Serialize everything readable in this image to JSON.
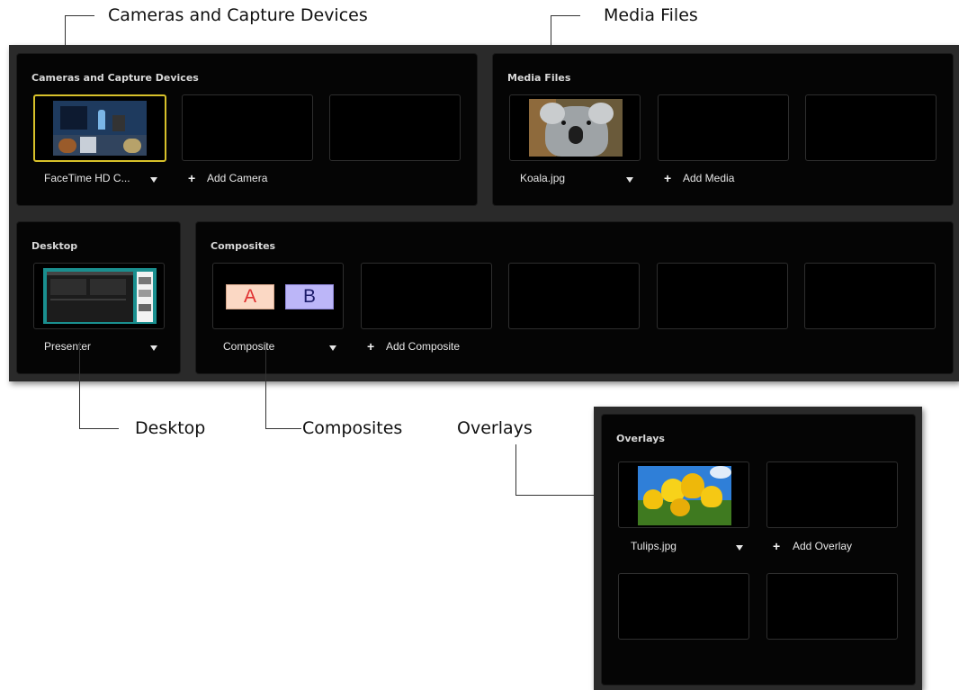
{
  "callouts": {
    "cameras": "Cameras and Capture Devices",
    "media": "Media Files",
    "desktop": "Desktop",
    "composites": "Composites",
    "overlays": "Overlays"
  },
  "panels": {
    "cameras": {
      "title": "Cameras and Capture Devices",
      "source_label": "FaceTime HD C...",
      "add_label": "Add Camera"
    },
    "media": {
      "title": "Media Files",
      "source_label": "Koala.jpg",
      "add_label": "Add Media"
    },
    "desktop": {
      "title": "Desktop",
      "source_label": "Presenter"
    },
    "composites": {
      "title": "Composites",
      "source_label": "Composite",
      "add_label": "Add Composite",
      "box_a": "A",
      "box_b": "B"
    },
    "overlays": {
      "title": "Overlays",
      "source_label": "Tulips.jpg",
      "add_label": "Add Overlay"
    }
  },
  "colors": {
    "active_border": "#d8c12a",
    "panel_bg": "#050505",
    "frame_bg": "#2a2a2a"
  }
}
